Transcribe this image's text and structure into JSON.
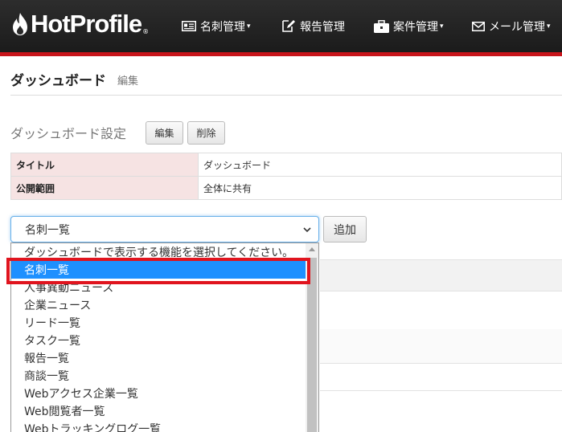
{
  "header": {
    "logo_text": "HotProfile",
    "logo_reg": "®",
    "nav": [
      {
        "label": "名刺管理",
        "has_caret": true,
        "icon": "card-icon"
      },
      {
        "label": "報告管理",
        "has_caret": false,
        "icon": "report-edit-icon"
      },
      {
        "label": "案件管理",
        "has_caret": true,
        "icon": "briefcase-icon"
      },
      {
        "label": "メール管理",
        "has_caret": true,
        "icon": "mail-icon"
      }
    ],
    "caret": "▾",
    "accent_color": "#c8141b"
  },
  "page": {
    "title": "ダッシュボード",
    "subtitle": "編集"
  },
  "settings": {
    "title": "ダッシュボード設定",
    "edit_button": "編集",
    "delete_button": "削除",
    "rows": [
      {
        "label": "タイトル",
        "value": "ダッシュボード"
      },
      {
        "label": "公開範囲",
        "value": "全体に共有"
      }
    ]
  },
  "selector": {
    "selected_value": "名刺一覧",
    "add_button": "追加",
    "options": [
      "ダッシュボードで表示する機能を選択してください。",
      "名刺一覧",
      "人事異動ニュース",
      "企業ニュース",
      "リード一覧",
      "タスク一覧",
      "報告一覧",
      "商談一覧",
      "Webアクセス企業一覧",
      "Web閲覧者一覧",
      "Webトラッキングログ一覧"
    ],
    "highlighted_index": 1,
    "highlight_color": "#1e90ff",
    "annotation_color": "#e0141e"
  }
}
